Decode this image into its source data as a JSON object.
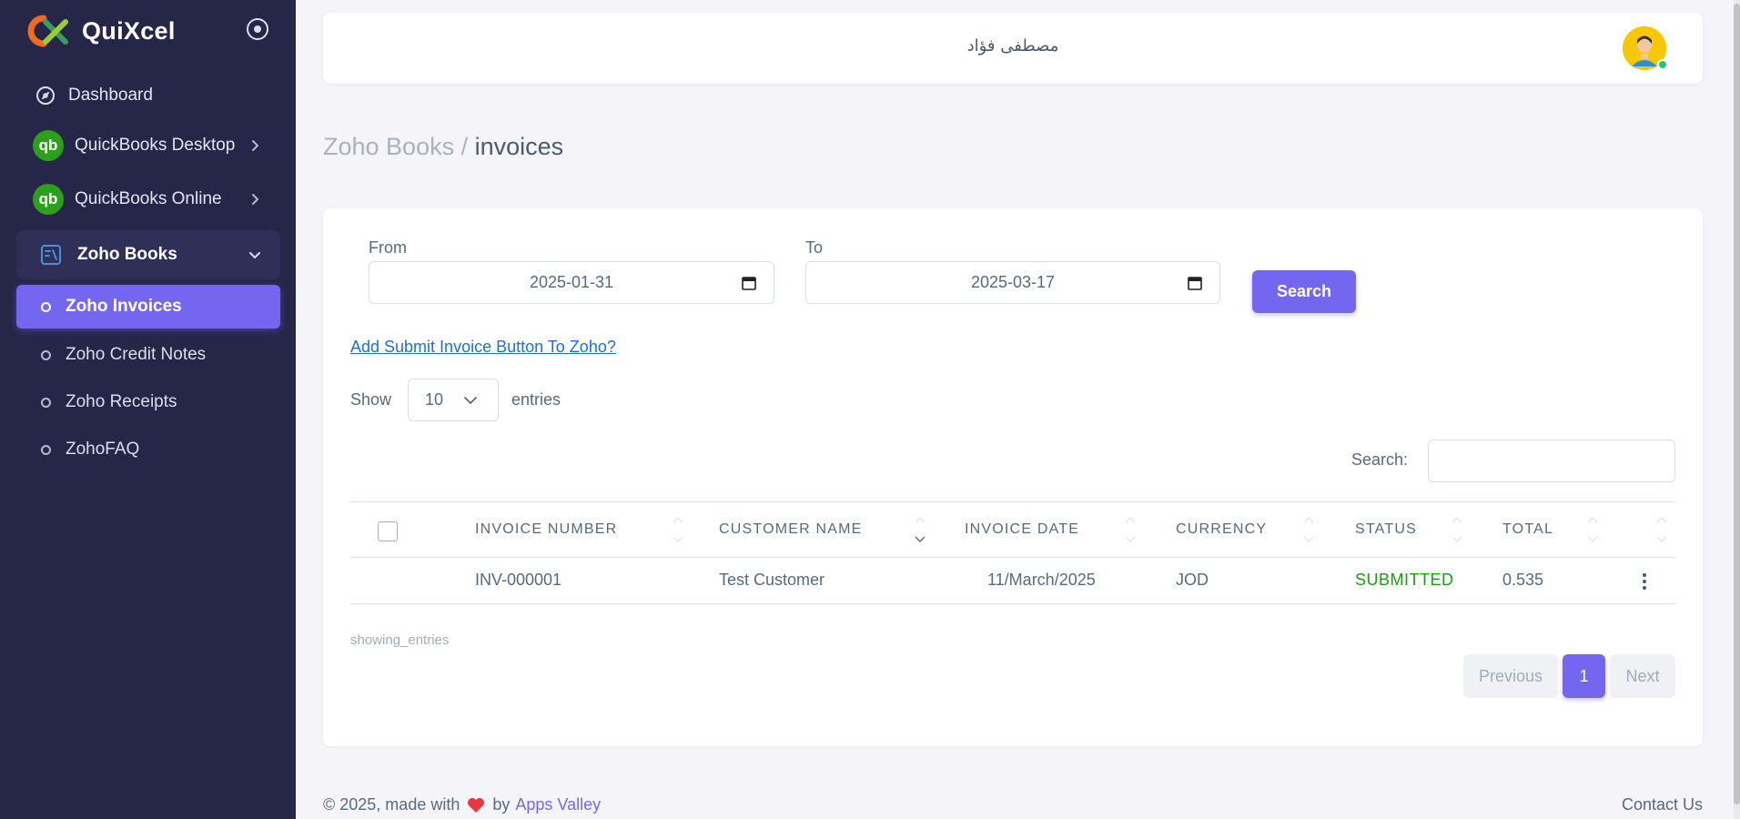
{
  "app": {
    "name": "QuiXcel"
  },
  "sidebar": {
    "items": [
      {
        "label": "Dashboard",
        "icon": "dashboard-icon"
      },
      {
        "label": "QuickBooks Desktop",
        "icon": "quickbooks-icon",
        "icon_text": "qb"
      },
      {
        "label": "QuickBooks Online",
        "icon": "quickbooks-icon",
        "icon_text": "qb"
      },
      {
        "label": "Zoho Books",
        "icon": "book-icon",
        "expanded": true
      }
    ],
    "sub_items": [
      {
        "label": "Zoho Invoices",
        "active": true
      },
      {
        "label": "Zoho Credit Notes"
      },
      {
        "label": "Zoho Receipts"
      },
      {
        "label": "ZohoFAQ"
      }
    ]
  },
  "navbar": {
    "user_name": "مصطفى فؤاد"
  },
  "breadcrumb": {
    "parent": "Zoho Books",
    "separator": "/",
    "current": "invoices"
  },
  "filters": {
    "from_label": "From",
    "from_value": "2025-01-31",
    "to_label": "To",
    "to_value": "2025-03-17",
    "search_button": "Search"
  },
  "add_button_link": "Add Submit Invoice Button To Zoho?",
  "length_menu": {
    "show": "Show",
    "value": "10",
    "entries": "entries"
  },
  "table_search": {
    "label": "Search:",
    "value": ""
  },
  "table": {
    "headers": [
      "INVOICE NUMBER",
      "CUSTOMER NAME",
      "INVOICE DATE",
      "CURRENCY",
      "STATUS",
      "TOTAL"
    ],
    "rows": [
      {
        "invoice_number": "INV-000001",
        "customer_name": "Test Customer",
        "invoice_date": "11/March/2025",
        "currency": "JOD",
        "status": "SUBMITTED",
        "total": "0.535"
      }
    ]
  },
  "info_text": "showing_entries",
  "pagination": {
    "previous": "Previous",
    "current": "1",
    "next": "Next"
  },
  "footer": {
    "copyright": "© 2025, made with",
    "by": "by",
    "brand": "Apps Valley",
    "contact": "Contact Us"
  },
  "colors": {
    "sidebar_bg": "#262649",
    "accent": "#7367f0",
    "status_submitted": "#16a00c",
    "qb_green": "#2ca01c"
  }
}
